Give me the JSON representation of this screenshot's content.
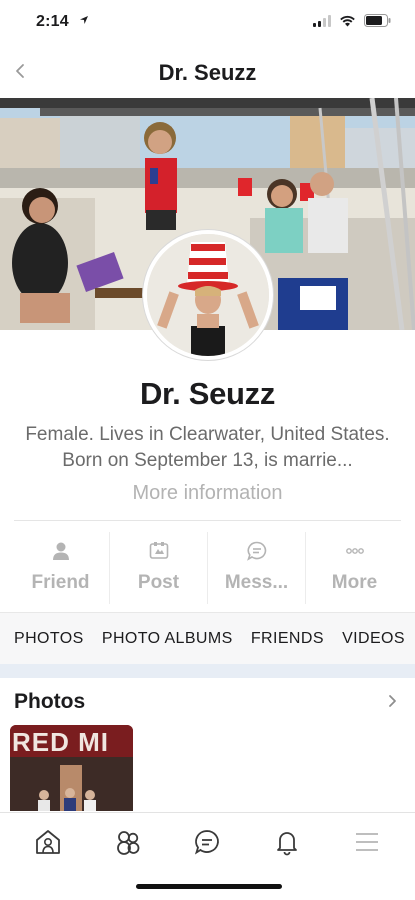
{
  "status_bar": {
    "time": "2:14",
    "icons": [
      "location-arrow-icon",
      "cellular-signal-icon",
      "wifi-icon",
      "battery-icon"
    ]
  },
  "nav": {
    "title": "Dr. Seuzz",
    "back_icon": "chevron-left-icon"
  },
  "profile": {
    "name": "Dr. Seuzz",
    "bio": "Female. Lives in Clearwater, United States. Born on September 13, is marrie...",
    "more_info": "More information"
  },
  "actions": [
    {
      "label": "Friend",
      "icon": "person-icon"
    },
    {
      "label": "Post",
      "icon": "post-icon"
    },
    {
      "label": "Mess...",
      "icon": "message-bubble-icon"
    },
    {
      "label": "More",
      "icon": "more-dots-icon"
    }
  ],
  "tabs": [
    "PHOTOS",
    "PHOTO ALBUMS",
    "FRIENDS",
    "VIDEOS"
  ],
  "photos_section": {
    "title": "Photos",
    "thumb_text": "RED MI"
  },
  "tabbar": [
    "home-icon",
    "friends-icon",
    "chat-icon",
    "bell-icon",
    "menu-icon"
  ],
  "colors": {
    "action_grey": "#b4b4b4",
    "tab_band": "#f7f7f8",
    "accent_band": "#e7edf5",
    "hat_red": "#d62828"
  }
}
